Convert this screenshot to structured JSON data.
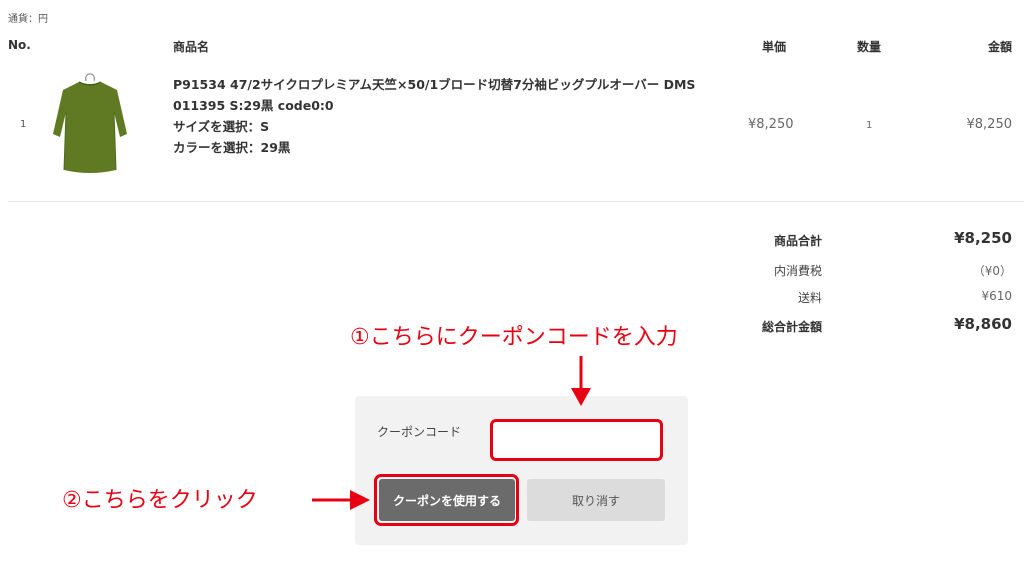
{
  "currency_note": "通貨：円",
  "table_headers": {
    "no": "No.",
    "product": "商品名",
    "unit_price": "単価",
    "quantity": "数量",
    "amount": "金額"
  },
  "item": {
    "no": "1",
    "name_line1": "P91534 47/2サイクロプレミアム天竺×50/1ブロード切替7分袖ビッグプルオーバー DMS",
    "name_line2": "011395 S:29黒 code0:0",
    "size_line": "サイズを選択：S",
    "color_line": "カラーを選択：29黒",
    "unit_price": "¥8,250",
    "quantity": "1",
    "amount": "¥8,250",
    "thumbnail_color": "#5f7a22"
  },
  "summary": {
    "subtotal_label": "商品合計",
    "subtotal_value": "¥8,250",
    "tax_label": "内消費税",
    "tax_value": "（¥0）",
    "shipping_label": "送料",
    "shipping_value": "¥610",
    "total_label": "総合計金額",
    "total_value": "¥8,860"
  },
  "coupon": {
    "label": "クーポンコード",
    "input_value": "",
    "apply_label": "クーポンを使用する",
    "cancel_label": "取り消す"
  },
  "annotations": {
    "step1": "①こちらにクーポンコードを入力",
    "step2": "②こちらをクリック",
    "color": "#e60012"
  }
}
